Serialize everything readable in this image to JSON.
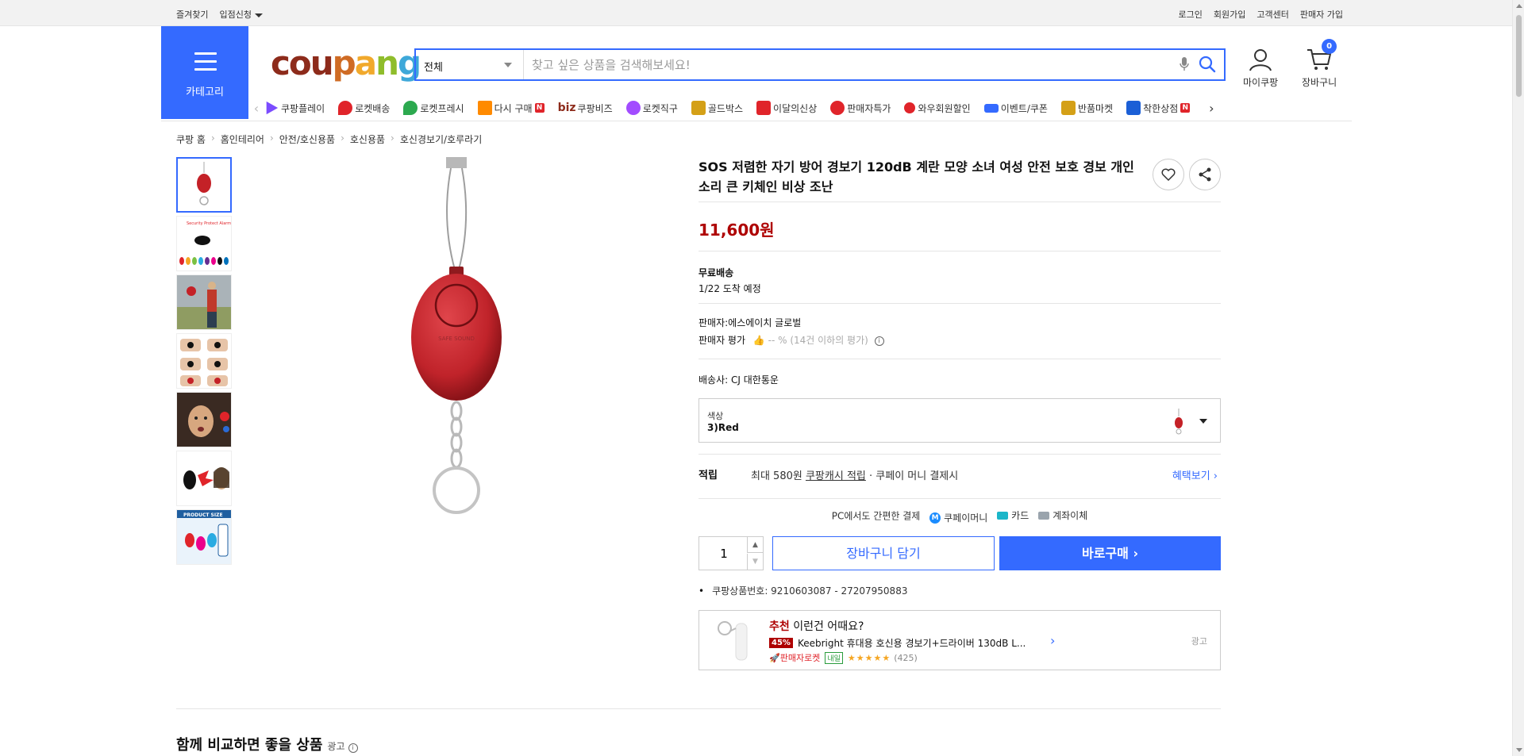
{
  "topbar": {
    "left": [
      "즐겨찾기",
      "입점신청"
    ],
    "right": [
      "로그인",
      "회원가입",
      "고객센터",
      "판매자 가입"
    ]
  },
  "header": {
    "category_label": "카테고리",
    "logo": [
      "cou",
      "p",
      "a",
      "n",
      "g"
    ],
    "search": {
      "scope": "전체",
      "placeholder": "찾고 싶은 상품을 검색해보세요!"
    },
    "mycoupang": "마이쿠팡",
    "cart": "장바구니",
    "cart_count": "0"
  },
  "nav": {
    "items": [
      {
        "label": "쿠팡플레이",
        "color": "#7b4cff"
      },
      {
        "label": "로켓배송",
        "color": "#e0242a"
      },
      {
        "label": "로켓프레시",
        "color": "#2ca94f"
      },
      {
        "label": "다시 구매",
        "color": "#ff8a00",
        "badge": "N"
      },
      {
        "label": "쿠팡비즈",
        "prefix": "biz",
        "color": "#8d2b1b"
      },
      {
        "label": "로켓직구",
        "color": "#a24cff"
      },
      {
        "label": "골드박스",
        "color": "#d4a017"
      },
      {
        "label": "이달의신상",
        "color": "#e0242a"
      },
      {
        "label": "판매자특가",
        "color": "#e0242a"
      },
      {
        "label": "와우회원할인",
        "color": "#e0242a"
      },
      {
        "label": "이벤트/쿠폰",
        "color": "#346aff"
      },
      {
        "label": "반품마켓",
        "color": "#d4a017"
      },
      {
        "label": "착한상점",
        "color": "#1b5fd6",
        "badge": "N"
      }
    ]
  },
  "breadcrumb": [
    "쿠팡 홈",
    "홈인테리어",
    "안전/호신용품",
    "호신용품",
    "호신경보기/호루라기"
  ],
  "product": {
    "title": "SOS 저렴한 자기 방어 경보기 120dB 계란 모양 소녀 여성 안전 보호 경보 개인 소리 큰 키체인 비상 조난",
    "price": "11,600원",
    "shipping_label": "무료배송",
    "arrival": "1/22 도착 예정",
    "seller": "판매자:에스에이치 글로벌",
    "seller_rating_label": "판매자 평가",
    "seller_rating_value": "-- % (14건 이하의 평가)",
    "carrier_label": "배송사:",
    "carrier": "CJ 대한통운",
    "option_label": "색상",
    "option_value": "3)Red",
    "reward_label": "적립",
    "reward_text": "최대 580원",
    "reward_link": "쿠팡캐시 적립",
    "reward_suffix": "· 쿠페이 머니 결제시",
    "reward_more": "혜택보기",
    "pc_pay_label": "PC에서도 간편한 결제",
    "pay_methods": [
      "쿠페이머니",
      "카드",
      "계좌이체"
    ],
    "quantity": "1",
    "cart_button": "장바구니 담기",
    "buy_button": "바로구매",
    "product_no": "쿠팡상품번호: 9210603087 - 27207950883"
  },
  "recommend": {
    "title_accent": "추천",
    "title_rest": "이런건 어때요?",
    "discount": "45%",
    "name": "Keebright 휴대용 호신용 경보기+드라이버 130dB L...",
    "rocket": "판매자로켓",
    "naeil": "내일",
    "stars": "★★★★★",
    "count": "(425)",
    "ad": "광고"
  },
  "compare": {
    "title": "함께 비교하면 좋을 상품",
    "ad": "광고"
  },
  "thumbnails": [
    "thumb-red-alarm",
    "thumb-color-variants",
    "thumb-person-outdoor",
    "thumb-usage-steps",
    "thumb-scared-face",
    "thumb-woman-alarm",
    "thumb-product-size"
  ]
}
